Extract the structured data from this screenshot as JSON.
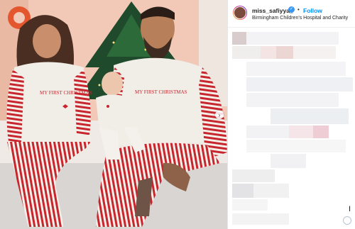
{
  "post": {
    "username": "miss_safiyya_",
    "verified_icon": "verified-badge-icon",
    "separator": "•",
    "follow_label": "Follow",
    "location": "Birmingham Children's Hospital and Charity"
  },
  "photo": {
    "shirt_text_mother": "MY FIRST CHRISTMAS",
    "shirt_text_father": "MY FIRST CHRISTMAS",
    "next_arrow": "›"
  },
  "colors": {
    "accent": "#0095f6",
    "stripe_red": "#c8262e",
    "tree_green": "#1f4a2c",
    "wall": "#f4c7b3"
  },
  "comments_area": {
    "state": "pixelated / blurred",
    "cursor_glyph": "I"
  }
}
